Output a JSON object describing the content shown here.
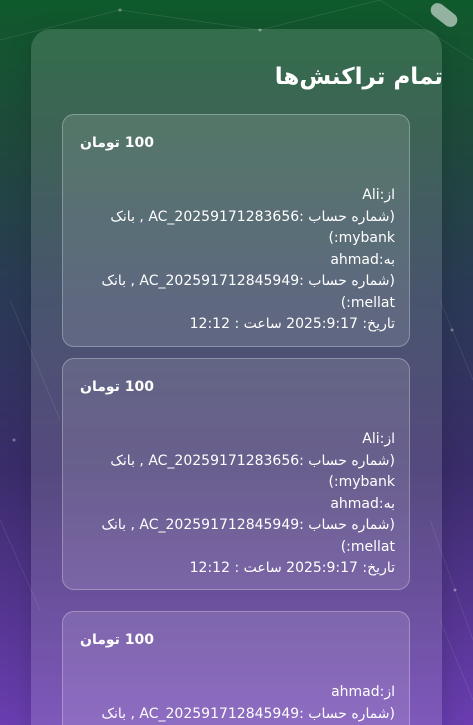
{
  "page": {
    "title": "تمام تراکنش‌ها"
  },
  "colors": {
    "bg_top": "#0f5a2c",
    "bg_bottom": "#6a3db0",
    "text": "#ffffff"
  },
  "transactions": [
    {
      "amount": "100 تومان",
      "lines": [
        "از:Ali",
        "(شماره حساب :AC_20259171283656 , بانک",
        "mybank:)",
        "به:ahmad",
        "(شماره حساب :AC_202591712845949 , بانک",
        "mellat:)",
        "تاریخ: 2025:9:17 ساعت : 12:12"
      ]
    },
    {
      "amount": "100 تومان",
      "lines": [
        "از:Ali",
        "(شماره حساب :AC_20259171283656 , بانک",
        "mybank:)",
        "به:ahmad",
        "(شماره حساب :AC_202591712845949 , بانک",
        "mellat:)",
        "تاریخ: 2025:9:17 ساعت : 12:12"
      ]
    },
    {
      "amount": "100 تومان",
      "lines": [
        "از:ahmad",
        "(شماره حساب :AC_202591712845949 , بانک"
      ]
    }
  ]
}
